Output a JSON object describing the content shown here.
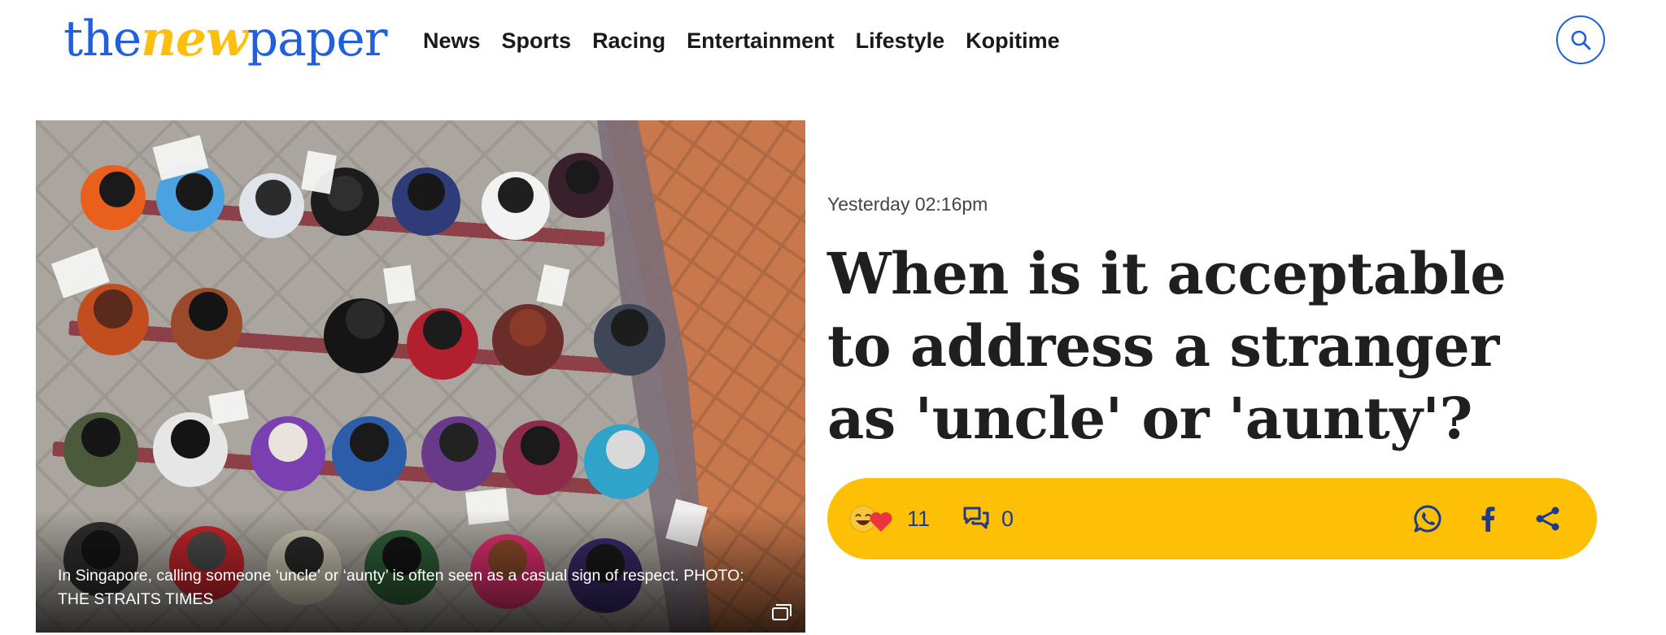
{
  "brand": {
    "logo_part1": "the",
    "logo_part2": "new",
    "logo_part3": "paper"
  },
  "nav": {
    "items": [
      {
        "label": "News"
      },
      {
        "label": "Sports"
      },
      {
        "label": "Racing"
      },
      {
        "label": "Entertainment"
      },
      {
        "label": "Lifestyle"
      },
      {
        "label": "Kopitime"
      }
    ],
    "search_icon": "search-icon"
  },
  "article": {
    "timestamp": "Yesterday 02:16pm",
    "headline": "When is it acceptable to address a stranger as 'uncle' or 'aunty'?",
    "image": {
      "caption": "In Singapore, calling someone ‘uncle’ or ‘aunty’ is often seen as a casual sign of respect. PHOTO: THE STRAITS TIMES",
      "gallery_icon": "gallery-icon"
    },
    "reactions": {
      "icon": "laugh-heart-emoji-icon",
      "count": "11"
    },
    "comments": {
      "icon": "comments-icon",
      "count": "0"
    },
    "share": {
      "icons": [
        "whatsapp-icon",
        "facebook-icon",
        "share-icon"
      ]
    }
  },
  "colors": {
    "brand_blue": "#1f5fe0",
    "brand_yellow": "#fcbf0f",
    "action_bar": "#fdc004",
    "action_text": "#1e3a8a",
    "headline": "#1f1f1f"
  }
}
